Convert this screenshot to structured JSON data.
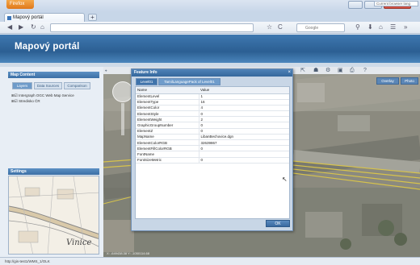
{
  "browser": {
    "app_button": "Firefox",
    "tab_title": "Mapový portál",
    "new_tab": "+",
    "search_placeholder": "Google"
  },
  "portal": {
    "title": "Mapový portál"
  },
  "sidebar": {
    "map_content_header": "Map Content",
    "tabs": [
      "Layers",
      "Data Sources",
      "Comparison"
    ],
    "tree_items": [
      "Intergraph OGC Web Map Service",
      "Stredisko ČR"
    ],
    "settings_header": "Settings",
    "overview_label": "Vinice"
  },
  "map": {
    "browse_placeholder": "Current browser lang",
    "map_type_buttons": [
      "Overlay",
      "Photo"
    ],
    "coordinates": "X: -649438.38  Y: -1050114.68"
  },
  "dialog": {
    "title": "Feature Info",
    "close": "×",
    "tabs": [
      "Level01",
      "TamilLanguagePack of Level01"
    ],
    "columns": [
      "Name",
      "Value"
    ],
    "rows": [
      [
        "ElementLevel",
        "1"
      ],
      [
        "ElementType",
        "16"
      ],
      [
        "ElementColor",
        "4"
      ],
      [
        "ElementStyle",
        "0"
      ],
      [
        "ElementWeight",
        "2"
      ],
      [
        "GraphicGroupNumber",
        "0"
      ],
      [
        "ElementZ",
        "0"
      ],
      [
        "MapName",
        "LibanBechovice.dgn"
      ],
      [
        "ElementColorRGB",
        "32639867"
      ],
      [
        "ElementFillColorRGB",
        "0"
      ],
      [
        "FontName",
        ""
      ],
      [
        "FontSizeMetric",
        "0"
      ]
    ],
    "ok_label": "OK"
  },
  "status_bar": {
    "text": "http://gis-test1/WMS_1/OLK"
  }
}
